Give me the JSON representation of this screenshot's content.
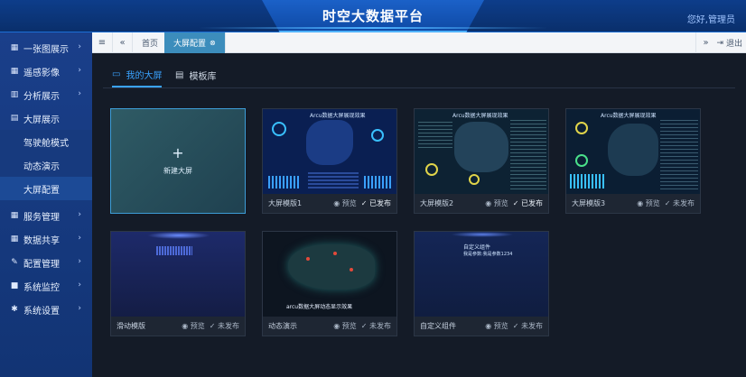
{
  "header": {
    "title": "时空大数据平台",
    "user": "您好,管理员"
  },
  "sidebar": {
    "items": [
      {
        "label": "一张图展示",
        "icon": "grid-icon"
      },
      {
        "label": "遥感影像",
        "icon": "grid-icon"
      },
      {
        "label": "分析展示",
        "icon": "bar-chart-icon"
      },
      {
        "label": "大屏展示",
        "icon": "film-icon"
      },
      {
        "label": "服务管理",
        "icon": "grid-icon"
      },
      {
        "label": "数据共享",
        "icon": "grid-icon"
      },
      {
        "label": "配置管理",
        "icon": "wrench-icon"
      },
      {
        "label": "系统监控",
        "icon": "camera-icon"
      },
      {
        "label": "系统设置",
        "icon": "gear-icon"
      }
    ],
    "sub_items": [
      "驾驶舱模式",
      "动态演示",
      "大屏配置"
    ]
  },
  "tabbar": {
    "home": "首页",
    "active_tab": "大屏配置",
    "logout": "退出"
  },
  "subtabs": {
    "mine": "我的大屏",
    "library": "模板库"
  },
  "new_card": {
    "label": "新建大屏"
  },
  "cards": [
    {
      "name": "大屏模版1",
      "preview": "预览",
      "status": "已发布",
      "thumb_title": "Arcu数据大屏展现效果"
    },
    {
      "name": "大屏模版2",
      "preview": "预览",
      "status": "已发布",
      "thumb_title": "Arcu数据大屏展现效果"
    },
    {
      "name": "大屏模版3",
      "preview": "预览",
      "status": "未发布",
      "thumb_title": "Arcu数据大屏展现效果"
    },
    {
      "name": "滑动模版",
      "preview": "预览",
      "status": "未发布"
    },
    {
      "name": "动态演示",
      "preview": "预览",
      "status": "未发布",
      "thumb_title": "arcu数据大屏动态显示效果"
    },
    {
      "name": "自定义组件",
      "preview": "预览",
      "status": "未发布",
      "thumb_title": "自定义组件",
      "thumb_sub": "我是参数:我是参数1234"
    }
  ]
}
